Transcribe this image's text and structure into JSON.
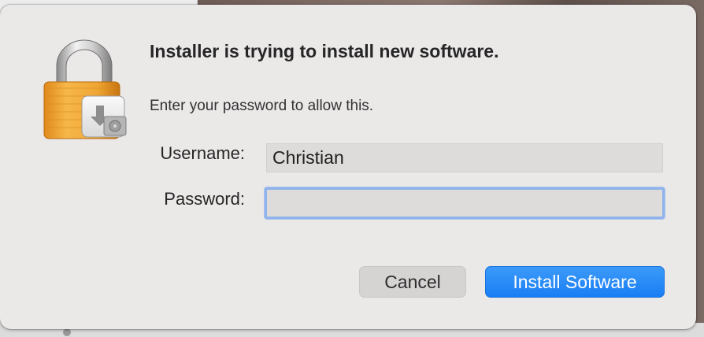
{
  "dialog": {
    "icon": "lock-installer-icon",
    "title": "Installer is trying to install new software.",
    "message": "Enter your password to allow this.",
    "username_label": "Username:",
    "username_value": "Christian",
    "password_label": "Password:",
    "password_value": "",
    "cancel_label": "Cancel",
    "confirm_label": "Install Software"
  },
  "colors": {
    "primary_button": "#1a7ef4",
    "focus_ring": "#8fb3ea",
    "dialog_background": "#ebe8e8"
  }
}
